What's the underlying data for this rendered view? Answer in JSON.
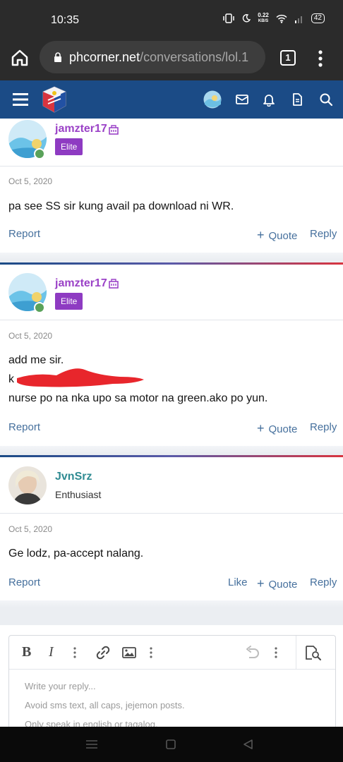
{
  "status_bar": {
    "time": "10:35",
    "net_speed_value": "0.22",
    "net_speed_unit": "KB/S",
    "battery": "42",
    "icons": [
      "vibrate-icon",
      "moon-icon",
      "wifi-icon",
      "signal-icon",
      "battery-icon"
    ]
  },
  "browser": {
    "url_host": "phcorner.net",
    "url_path": "/conversations/lol.1",
    "tab_count": "1",
    "icons": [
      "home-icon",
      "lock-icon",
      "kebab-menu-icon"
    ]
  },
  "site_header": {
    "icons": [
      "hamburger-icon",
      "site-logo",
      "avatar",
      "mail-icon",
      "bell-icon",
      "document-icon",
      "search-icon"
    ]
  },
  "posts": [
    {
      "username": "jamzter17",
      "role": "Elite",
      "date": "Oct 5, 2020",
      "body_lines": [
        "pa see SS sir kung avail pa download ni WR."
      ],
      "actions": {
        "report": "Report",
        "quote": "Quote",
        "reply": "Reply"
      }
    },
    {
      "username": "jamzter17",
      "role": "Elite",
      "date": "Oct 5, 2020",
      "body_lines": [
        "add me sir.",
        "k",
        "nurse po na nka upo sa motor na green.ako po yun."
      ],
      "actions": {
        "report": "Report",
        "quote": "Quote",
        "reply": "Reply"
      }
    },
    {
      "username": "JvnSrz",
      "role": "Enthusiast",
      "date": "Oct 5, 2020",
      "body_lines": [
        "Ge lodz, pa-accept nalang."
      ],
      "actions": {
        "report": "Report",
        "like": "Like",
        "quote": "Quote",
        "reply": "Reply"
      }
    }
  ],
  "editor": {
    "toolbar_icons": [
      "bold-icon",
      "italic-icon",
      "more-icon",
      "link-icon",
      "image-icon",
      "more-icon",
      "undo-icon",
      "more-icon",
      "preview-icon"
    ],
    "bold_glyph": "B",
    "italic_glyph": "I",
    "placeholder_lines": [
      "Write your reply...",
      "Avoid sms text, all caps, jejemon posts.",
      "Only speak in english or tagalog."
    ]
  },
  "colors": {
    "header": "#1b4b86",
    "username_purple": "#9b42c7",
    "username_teal": "#2f8b92",
    "elite_badge": "#8e3bc2",
    "action_link": "#46709d",
    "redaction": "#e8262c"
  }
}
